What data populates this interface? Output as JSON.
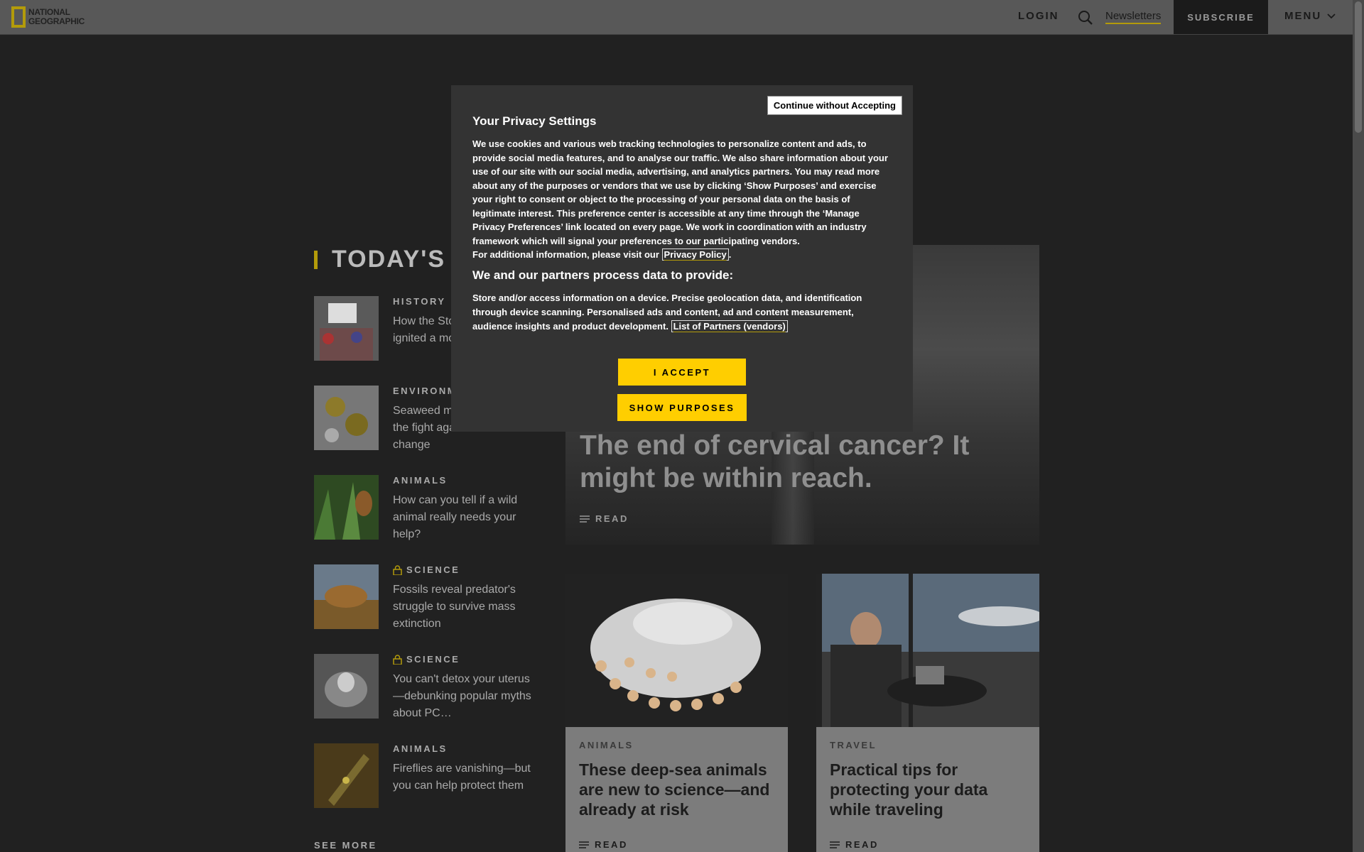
{
  "header": {
    "logo_line1": "NATIONAL",
    "logo_line2": "GEOGRAPHIC",
    "login": "LOGIN",
    "newsletters": "Newsletters",
    "subscribe": "SUBSCRIBE",
    "menu": "MENU"
  },
  "todays": {
    "heading": "TODAY'S",
    "items": [
      {
        "category": "HISTORY",
        "title": "How the Stonewall uprising ignited a movement",
        "locked": false
      },
      {
        "category": "ENVIRONMENT",
        "title": "Seaweed may play a role in the fight against climate change",
        "locked": false
      },
      {
        "category": "ANIMALS",
        "title": "How can you tell if a wild animal really needs your help?",
        "locked": false
      },
      {
        "category": "SCIENCE",
        "title": "Fossils reveal predator's struggle to survive mass extinction",
        "locked": true
      },
      {
        "category": "SCIENCE",
        "title": "You can't detox your uterus—debunking popular myths about PC…",
        "locked": true
      },
      {
        "category": "ANIMALS",
        "title": "Fireflies are vanishing—but you can help protect them",
        "locked": false
      }
    ],
    "see_more": "SEE MORE"
  },
  "hero": {
    "title": "The end of cervical cancer? It might be within reach.",
    "read": "READ"
  },
  "cards": [
    {
      "category": "ANIMALS",
      "title": "These deep-sea animals are new to science—and already at risk",
      "read": "READ"
    },
    {
      "category": "TRAVEL",
      "title": "Practical tips for protecting your data while traveling",
      "read": "READ"
    }
  ],
  "modal": {
    "continue": "Continue without Accepting",
    "title": "Your Privacy Settings",
    "body": "We use cookies and various web tracking technologies to personalize content and ads, to provide social media features, and to analyse our traffic. We also share information about your use of our site with our social media, advertising, and analytics partners. You may read more about any of the purposes or vendors that we use by clicking ‘Show Purposes’ and exercise your right to consent or object to the processing of your personal data on the basis of legitimate interest. This preference center is accessible at any time through the ‘Manage Privacy Preferences’ link located on every page. We work in coordination with an industry framework which will signal your preferences to our participating vendors.",
    "visit_text": "For additional information, please visit our",
    "privacy_link": "Privacy Policy",
    "partners_heading": "We and our partners process data to provide:",
    "purposes": "Store and/or access information on a device. Precise geolocation data, and identification through device scanning. Personalised ads and content, ad and content measurement, audience insights and product development.",
    "vendors_link": "List of Partners (vendors)",
    "accept": "I ACCEPT",
    "show_purposes": "SHOW PURPOSES"
  },
  "colors": {
    "accent": "#ffce00",
    "brand_yellow": "#b39b0a",
    "overlay_bg": "#212121",
    "modal_bg": "#333333"
  },
  "icons": [
    "search-icon",
    "chevron-down-icon",
    "lock-icon",
    "read-lines-icon"
  ]
}
